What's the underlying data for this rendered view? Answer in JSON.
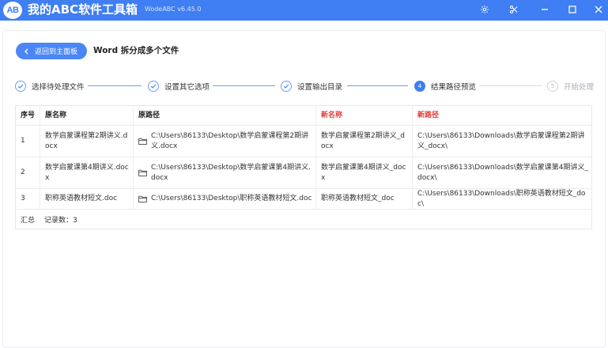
{
  "app": {
    "logo_text": "AB",
    "title": "我的ABC软件工具箱",
    "version": "WodeABC v6.45.0"
  },
  "toolbar": {
    "back_label": "返回到主面板",
    "page_title": "Word 拆分成多个文件"
  },
  "steps": [
    {
      "label": "选择待处理文件",
      "state": "done"
    },
    {
      "label": "设置其它选项",
      "state": "done"
    },
    {
      "label": "设置输出目录",
      "state": "done"
    },
    {
      "label": "结果路径预览",
      "state": "active",
      "number": "4"
    },
    {
      "label": "开始处理",
      "state": "todo",
      "number": "5"
    }
  ],
  "table": {
    "headers": [
      "序号",
      "原名称",
      "原路径",
      "新名称",
      "新路径"
    ],
    "rows": [
      {
        "index": "1",
        "orig_name": "数学启蒙课程第2期讲义.docx",
        "orig_path": "C:\\Users\\86133\\Desktop\\数学启蒙课程第2期讲义.docx",
        "new_name": "数学启蒙课程第2期讲义_docx",
        "new_path": "C:\\Users\\86133\\Downloads\\数学启蒙课程第2期讲义_docx\\"
      },
      {
        "index": "2",
        "orig_name": "数学启蒙课第4期讲义.docx",
        "orig_path": "C:\\Users\\86133\\Desktop\\数学启蒙课第4期讲义.docx",
        "new_name": "数学启蒙课第4期讲义_docx",
        "new_path": "C:\\Users\\86133\\Downloads\\数学启蒙课第4期讲义_docx\\"
      },
      {
        "index": "3",
        "orig_name": "职称英语教材短文.doc",
        "orig_path": "C:\\Users\\86133\\Desktop\\职称英语教材短文.doc",
        "new_name": "职称英语教材短文_doc",
        "new_path": "C:\\Users\\86133\\Downloads\\职称英语教材短文_doc\\"
      }
    ],
    "summary_label": "汇总",
    "summary_count": "记录数：3"
  },
  "colors": {
    "accent": "#3f7ef3",
    "highlight_header": "#e53935"
  }
}
